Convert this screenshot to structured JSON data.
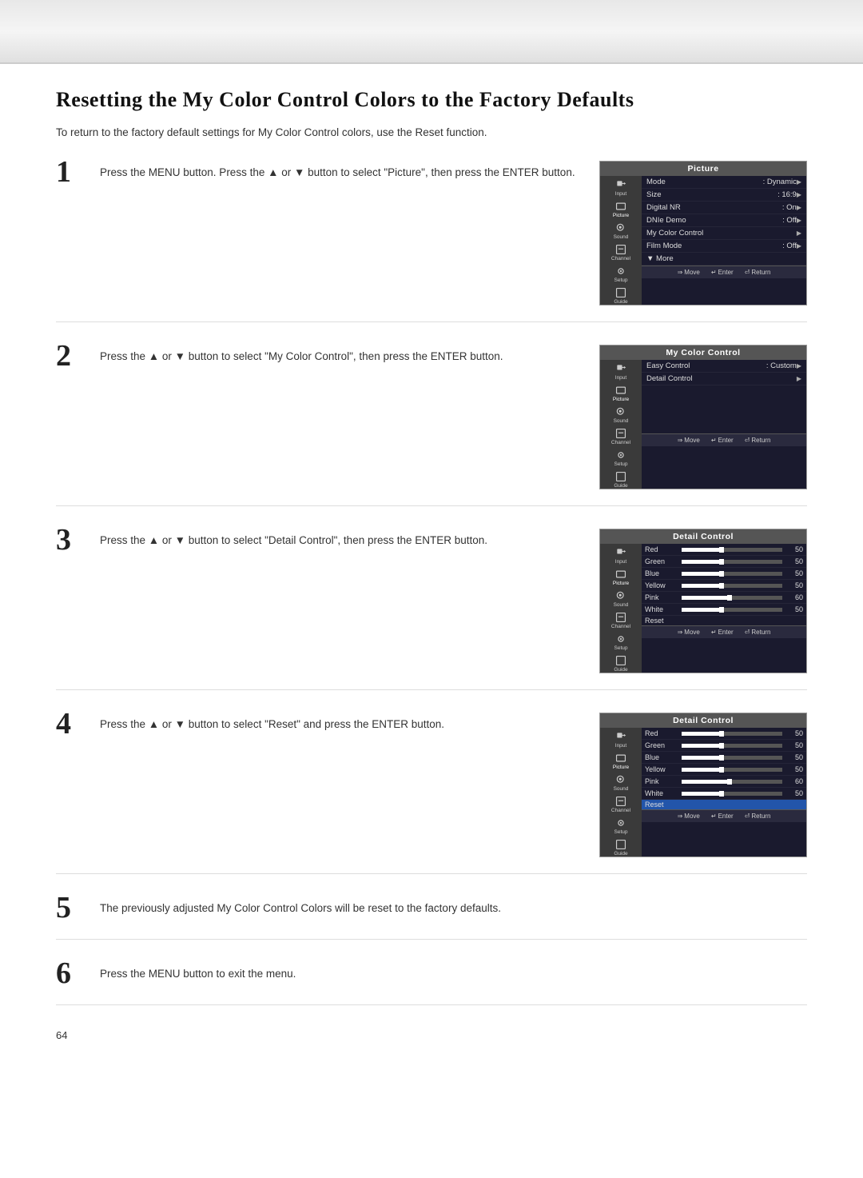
{
  "header": {},
  "page": {
    "title": "Resetting the My Color Control Colors to the Factory Defaults",
    "intro": "To return to the factory default settings for My Color Control colors, use the Reset function.",
    "page_number": "64"
  },
  "steps": [
    {
      "number": "1",
      "text": "Press the MENU button. Press the ▲ or ▼ button to select \"Picture\", then press the ENTER button.",
      "screen": {
        "title": "Picture",
        "menu_items": [
          {
            "label": "Mode",
            "value": ": Dynamic",
            "arrow": true,
            "highlighted": false
          },
          {
            "label": "Size",
            "value": ": 16:9",
            "arrow": true,
            "highlighted": false
          },
          {
            "label": "Digital NR",
            "value": ": On",
            "arrow": true,
            "highlighted": false
          },
          {
            "label": "DNIe Demo",
            "value": ": Off",
            "arrow": true,
            "highlighted": false
          },
          {
            "label": "My Color Control",
            "value": "",
            "arrow": true,
            "highlighted": false
          },
          {
            "label": "Film Mode",
            "value": ": Off",
            "arrow": true,
            "highlighted": false
          },
          {
            "label": "▼ More",
            "value": "",
            "arrow": false,
            "highlighted": false
          }
        ]
      }
    },
    {
      "number": "2",
      "text": "Press the ▲ or ▼ button to select \"My Color Control\", then press the ENTER button.",
      "screen": {
        "title": "My Color Control",
        "menu_items": [
          {
            "label": "Easy Control",
            "value": ": Custom",
            "arrow": true,
            "highlighted": false
          },
          {
            "label": "Detail Control",
            "value": "",
            "arrow": true,
            "highlighted": false
          }
        ]
      }
    },
    {
      "number": "3",
      "text": "Press the ▲ or ▼ button to select \"Detail Control\", then press the ENTER button.",
      "screen": {
        "title": "Detail Control",
        "detail_items": [
          {
            "label": "Red",
            "value": 50,
            "highlighted": false
          },
          {
            "label": "Green",
            "value": 50,
            "highlighted": false
          },
          {
            "label": "Blue",
            "value": 50,
            "highlighted": false
          },
          {
            "label": "Yellow",
            "value": 50,
            "highlighted": false
          },
          {
            "label": "Pink",
            "value": 60,
            "highlighted": false
          },
          {
            "label": "White",
            "value": 50,
            "highlighted": false
          }
        ],
        "reset": false
      }
    },
    {
      "number": "4",
      "text": "Press the ▲ or ▼ button to select \"Reset\" and press the ENTER button.",
      "screen": {
        "title": "Detail Control",
        "detail_items": [
          {
            "label": "Red",
            "value": 50,
            "highlighted": false
          },
          {
            "label": "Green",
            "value": 50,
            "highlighted": false
          },
          {
            "label": "Blue",
            "value": 50,
            "highlighted": false
          },
          {
            "label": "Yellow",
            "value": 50,
            "highlighted": false
          },
          {
            "label": "Pink",
            "value": 60,
            "highlighted": false
          },
          {
            "label": "White",
            "value": 50,
            "highlighted": false
          }
        ],
        "reset": true
      }
    },
    {
      "number": "5",
      "text": "The previously adjusted My Color Control Colors will be reset to the factory defaults.",
      "no_screen": true
    },
    {
      "number": "6",
      "text": "Press the MENU button to exit the menu.",
      "no_screen": true,
      "has_separator": true
    }
  ],
  "footer": {
    "move_label": "Move",
    "enter_label": "Enter",
    "return_label": "Return"
  }
}
